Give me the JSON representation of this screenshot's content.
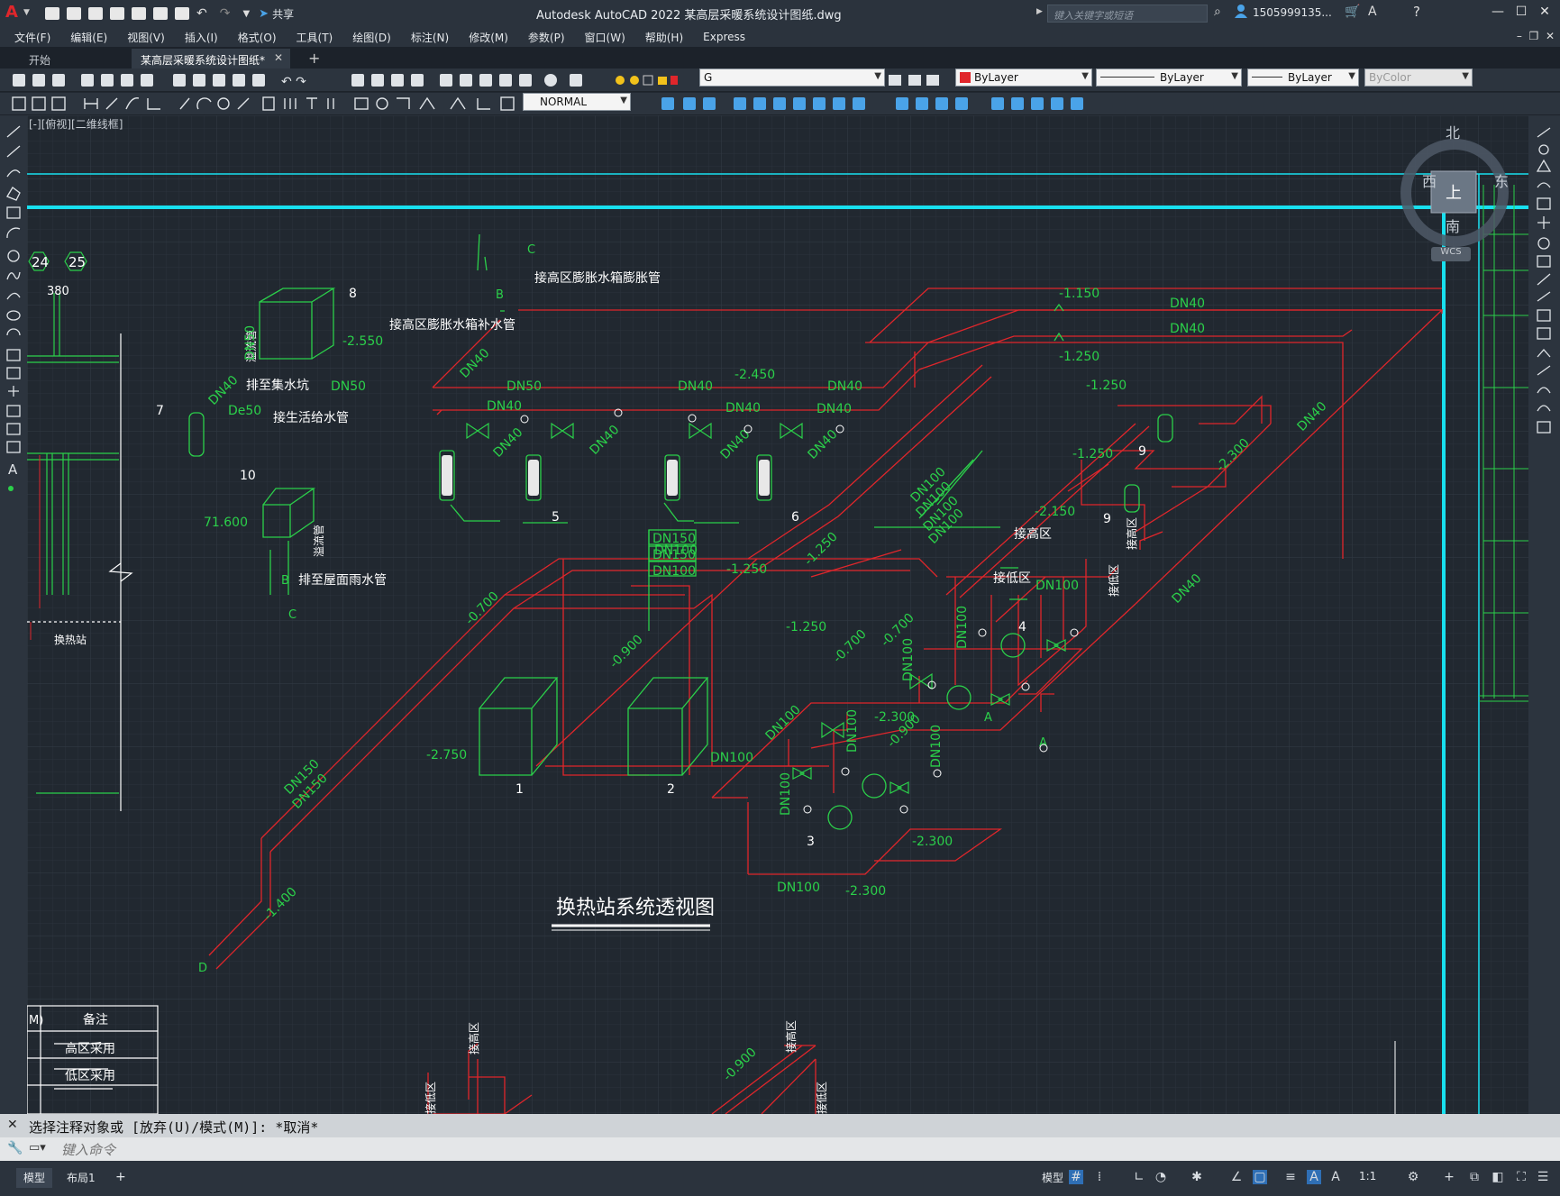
{
  "app": {
    "title": "Autodesk AutoCAD 2022    某高层采暖系统设计图纸.dwg",
    "share_label": "共享",
    "search_placeholder": "键入关键字或短语",
    "user": "1505999135...",
    "accent_color": "#e0262b"
  },
  "menu": [
    "文件(F)",
    "编辑(E)",
    "视图(V)",
    "插入(I)",
    "格式(O)",
    "工具(T)",
    "绘图(D)",
    "标注(N)",
    "修改(M)",
    "参数(P)",
    "窗口(W)",
    "帮助(H)",
    "Express"
  ],
  "tabs": [
    {
      "label": "开始",
      "active": false
    },
    {
      "label": "某高层采暖系统设计图纸*",
      "active": true
    }
  ],
  "toolbar": {
    "layer_value": "G",
    "color_value": "ByLayer",
    "linetype_value": "ByLayer",
    "lineweight_value": "ByLayer",
    "plotstyle_value": "ByColor",
    "dimstyle_value": "NORMAL"
  },
  "viewport_label": "[-][俯视][二维线框]",
  "viewcube": {
    "north": "北",
    "south": "南",
    "east": "东",
    "west": "西",
    "top": "上",
    "wcs": "WCS"
  },
  "drawing": {
    "title": "换热站系统透视图",
    "grid_labels": [
      "24",
      "25"
    ],
    "dim_380": "380",
    "notes": {
      "high_exp_tank": "接高区膨胀水箱膨胀管",
      "high_exp_refill": "接高区膨胀水箱补水管",
      "drain_pit": "排至集水坑",
      "domestic_water": "接生活给水管",
      "roof_drain": "排至屋面雨水管",
      "overflow": "溢流管",
      "to_high": "接高区",
      "to_low": "接低区",
      "station": "换热站"
    },
    "pipe_labels": {
      "dn40": "DN40",
      "dn50": "DN50",
      "dn100": "DN100",
      "dn150": "DN150",
      "de50": "De50"
    },
    "elevations": {
      "e1": "-1.150",
      "e2": "-1.250",
      "e3": "-2.450",
      "e4": "-2.550",
      "e5": "71.600",
      "e6": "-2.150",
      "e7": "-2.300",
      "e8": "-0.700",
      "e9": "-0.900",
      "e10": "-2.750",
      "e11": "-1.400",
      "e12": "-0.900"
    },
    "markers": {
      "a": "A",
      "b": "B",
      "c": "C",
      "d": "D"
    },
    "tags": [
      "1",
      "2",
      "3",
      "4",
      "5",
      "6",
      "7",
      "8",
      "9",
      "10"
    ],
    "legend": {
      "header_m": "M)",
      "header_note": "备注",
      "row1": "高区采用",
      "row2": "低区采用"
    }
  },
  "command": {
    "history": "选择注释对象或 [放弃(U)/模式(M)]: *取消*",
    "placeholder": "键入命令"
  },
  "status": {
    "model_tab": "模型",
    "layout_tab": "布局1",
    "add_tab": "+",
    "model_button": "模型",
    "scale": "1:1"
  }
}
